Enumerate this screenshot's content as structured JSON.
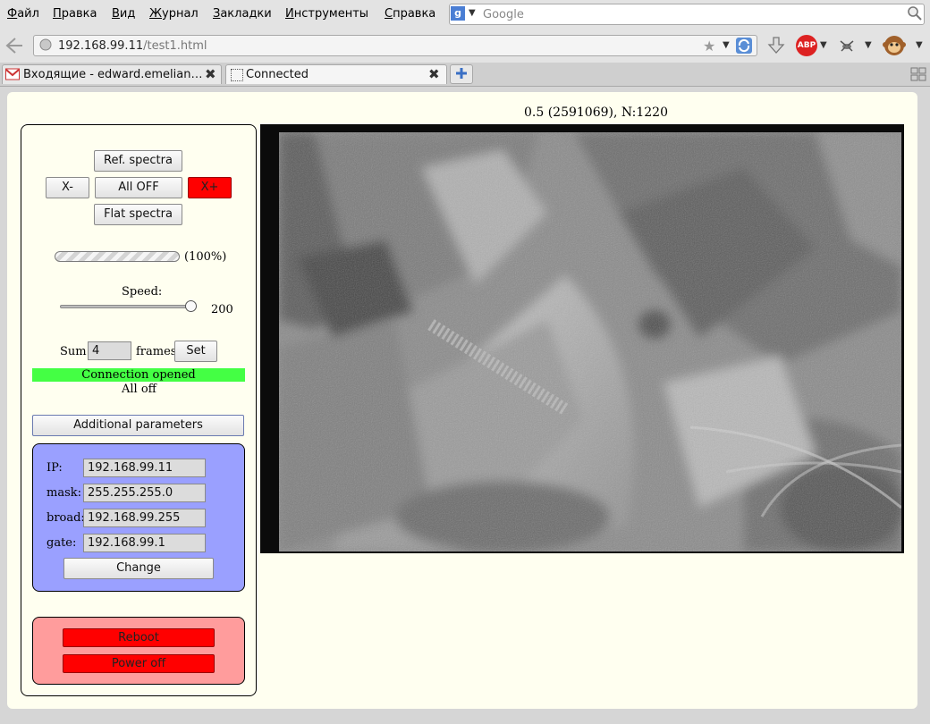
{
  "menu": [
    "Файл",
    "Правка",
    "Вид",
    "Журнал",
    "Закладки",
    "Инструменты",
    "Справка"
  ],
  "search": {
    "engine_glyph": "g",
    "placeholder": "Google"
  },
  "address": {
    "host": "192.168.99.11",
    "path": "/test1.html"
  },
  "addons": {
    "abp": "ABP"
  },
  "tabs": [
    {
      "label": "Входящие - edward.emelian…",
      "close": "✖"
    },
    {
      "label": "Connected",
      "close": "✖"
    }
  ],
  "status_line": "0.5 (2591069), N:1220",
  "controls": {
    "ref_spectra": "Ref. spectra",
    "x_minus": "X-",
    "all_off": "All OFF",
    "x_plus": "X+",
    "flat_spectra": "Flat spectra",
    "progress_percent": 100,
    "progress_text": "(100%)",
    "speed_label": "Speed:",
    "speed_value": "200",
    "speed_fraction": 1.0,
    "sum_label": "Sum",
    "sum_value": "4",
    "frames_label": "frames",
    "set_button": "Set",
    "connection_status": "Connection opened",
    "state_text": "All off",
    "additional_params": "Additional parameters"
  },
  "network": {
    "ip_label": "IP:",
    "ip": "192.168.99.11",
    "mask_label": "mask:",
    "mask": "255.255.255.0",
    "broad_label": "broad:",
    "broad": "192.168.99.255",
    "gate_label": "gate:",
    "gate": "192.168.99.1",
    "change_button": "Change"
  },
  "power": {
    "reboot": "Reboot",
    "power_off": "Power off"
  },
  "colors": {
    "connection_ok": "#44ff44",
    "network_panel": "#9aa0ff",
    "power_panel": "#ff9c9c",
    "danger": "#ff0000"
  }
}
